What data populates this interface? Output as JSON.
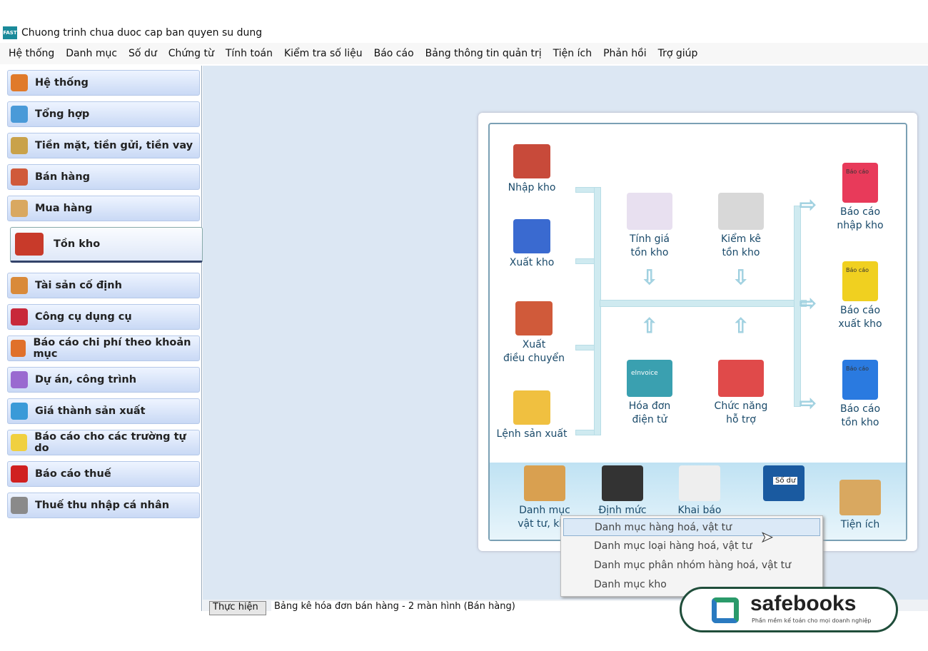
{
  "window": {
    "title": "Chuong trinh chua duoc cap ban quyen su dung",
    "icon_text": "FAST"
  },
  "menu": [
    "Hệ thống",
    "Danh mục",
    "Số dư",
    "Chứng từ",
    "Tính toán",
    "Kiểm tra số liệu",
    "Báo cáo",
    "Bảng thông tin quản trị",
    "Tiện ích",
    "Phản hồi",
    "Trợ giúp"
  ],
  "sidebar": {
    "active": "Tồn kho",
    "items": [
      {
        "label": "Hệ thống",
        "icon": "gear-icon",
        "color": "#e07a2a"
      },
      {
        "label": "Tổng hợp",
        "icon": "chart-icon",
        "color": "#4a9ad8"
      },
      {
        "label": "Tiền mặt, tiền gửi, tiền vay",
        "icon": "bank-icon",
        "color": "#c9a24a"
      },
      {
        "label": "Bán hàng",
        "icon": "cart-icon",
        "color": "#d05a3a"
      },
      {
        "label": "Mua hàng",
        "icon": "basket-icon",
        "color": "#d9a860"
      },
      {
        "label": "Tồn kho",
        "icon": "warehouse-icon",
        "color": "#c83a2a"
      },
      {
        "label": "Tài sản cố định",
        "icon": "house-icon",
        "color": "#d98a3a"
      },
      {
        "label": "Công cụ dụng cụ",
        "icon": "bag-icon",
        "color": "#c8283a"
      },
      {
        "label": "Báo cáo chi phí theo khoản mục",
        "icon": "bar-chart-icon",
        "color": "#e0702a"
      },
      {
        "label": "Dự án, công trình",
        "icon": "project-icon",
        "color": "#9a6ad0"
      },
      {
        "label": "Giá thành sản xuất",
        "icon": "calculator-icon",
        "color": "#3a9ad8"
      },
      {
        "label": "Báo cáo cho các trường tự do",
        "icon": "note-icon",
        "color": "#f0d040"
      },
      {
        "label": "Báo cáo thuế",
        "icon": "percent-icon",
        "color": "#d02020"
      },
      {
        "label": "Thuế thu nhập cá nhân",
        "icon": "person-icon",
        "color": "#8a8a8a"
      }
    ]
  },
  "diagram": {
    "left": [
      {
        "label": "Nhập kho"
      },
      {
        "label": "Xuất kho"
      },
      {
        "label": "Xuất\nđiều chuyển"
      },
      {
        "label": "Lệnh sản xuất"
      }
    ],
    "center": [
      {
        "label": "Tính giá\ntồn kho"
      },
      {
        "label": "Kiểm kê\ntồn kho"
      },
      {
        "label": "Hóa đơn\nđiện tử",
        "icon_text": "eInvoice"
      },
      {
        "label": "Chức năng\nhỗ trợ"
      }
    ],
    "right": [
      {
        "label": "Báo cáo\nnhập kho",
        "color": "#e83a5a"
      },
      {
        "label": "Báo cáo\nxuất kho",
        "color": "#f0d020"
      },
      {
        "label": "Báo cáo\ntồn kho",
        "color": "#2a7ae0"
      }
    ],
    "book_cover_text": "Báo cáo",
    "bottom": [
      {
        "label": "Danh mục\nvật tư, kho"
      },
      {
        "label": "Định mức"
      },
      {
        "label": "Khai báo"
      },
      {
        "label": "",
        "icon_text": "Số dư"
      },
      {
        "label": "Tiện ích"
      }
    ]
  },
  "context_menu": {
    "items": [
      "Danh mục hàng hoá, vật tư",
      "Danh mục loại hàng hoá, vật tư",
      "Danh mục phân nhóm hàng hoá, vật tư",
      "Danh mục kho"
    ],
    "highlighted": 0
  },
  "status": {
    "button": "Thực hiện",
    "current": "Bảng kê hóa đơn bán hàng - 2 màn hình (Bán hàng)"
  },
  "watermark": {
    "brand": "safebooks",
    "tagline": "Phần mềm kế toán cho mọi doanh nghiệp"
  }
}
